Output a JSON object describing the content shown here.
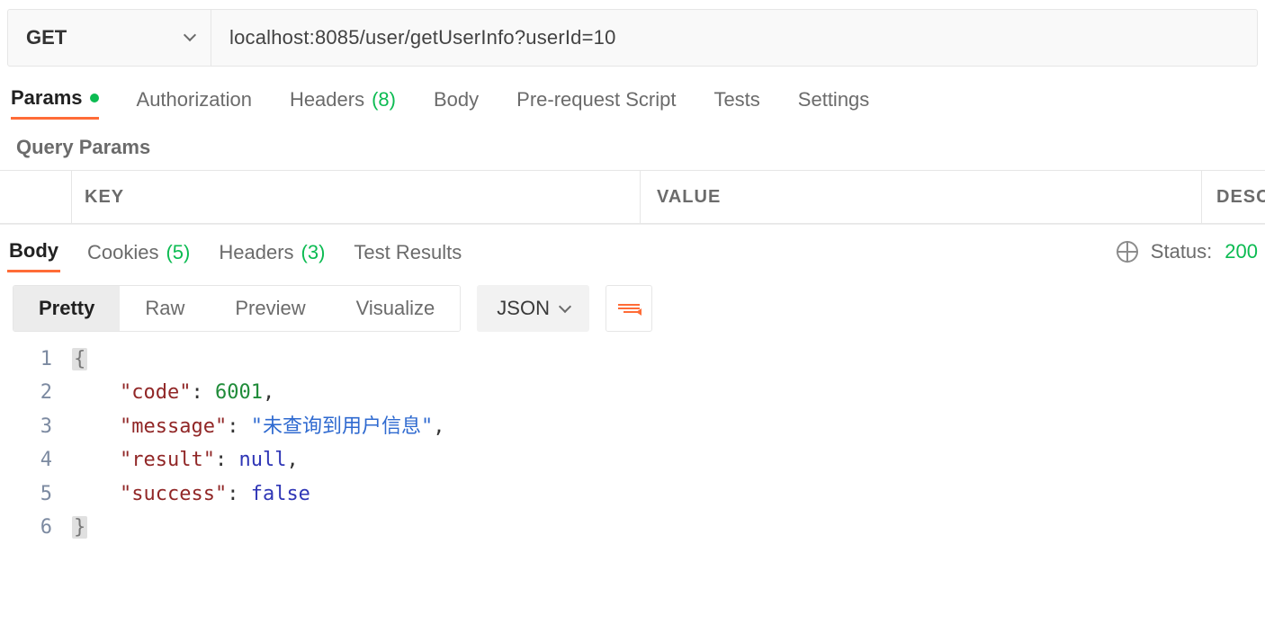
{
  "request": {
    "method": "GET",
    "url": "localhost:8085/user/getUserInfo?userId=10"
  },
  "request_tabs": {
    "params": "Params",
    "authorization": "Authorization",
    "headers": "Headers",
    "headers_count": "(8)",
    "body": "Body",
    "pre": "Pre-request Script",
    "tests": "Tests",
    "settings": "Settings"
  },
  "params_section": {
    "title": "Query Params",
    "columns": {
      "key": "KEY",
      "value": "VALUE",
      "desc": "DESC"
    }
  },
  "response_tabs": {
    "body": "Body",
    "cookies": "Cookies",
    "cookies_count": "(5)",
    "headers": "Headers",
    "headers_count": "(3)",
    "test_results": "Test Results"
  },
  "response_status": {
    "label": "Status:",
    "code": "200"
  },
  "response_view": {
    "pretty": "Pretty",
    "raw": "Raw",
    "preview": "Preview",
    "visualize": "Visualize",
    "format": "JSON"
  },
  "response_body": [
    {
      "n": "1",
      "indent": 0,
      "tokens": [
        {
          "t": "brace",
          "v": "{"
        }
      ]
    },
    {
      "n": "2",
      "indent": 1,
      "tokens": [
        {
          "t": "key",
          "v": "\"code\""
        },
        {
          "t": "plain",
          "v": ": "
        },
        {
          "t": "num",
          "v": "6001"
        },
        {
          "t": "plain",
          "v": ","
        }
      ]
    },
    {
      "n": "3",
      "indent": 1,
      "tokens": [
        {
          "t": "key",
          "v": "\"message\""
        },
        {
          "t": "plain",
          "v": ": "
        },
        {
          "t": "str",
          "v": "\"未查询到用户信息\""
        },
        {
          "t": "plain",
          "v": ","
        }
      ]
    },
    {
      "n": "4",
      "indent": 1,
      "tokens": [
        {
          "t": "key",
          "v": "\"result\""
        },
        {
          "t": "plain",
          "v": ": "
        },
        {
          "t": "kw",
          "v": "null"
        },
        {
          "t": "plain",
          "v": ","
        }
      ]
    },
    {
      "n": "5",
      "indent": 1,
      "tokens": [
        {
          "t": "key",
          "v": "\"success\""
        },
        {
          "t": "plain",
          "v": ": "
        },
        {
          "t": "kw",
          "v": "false"
        }
      ]
    },
    {
      "n": "6",
      "indent": 0,
      "tokens": [
        {
          "t": "brace",
          "v": "}"
        }
      ]
    }
  ]
}
